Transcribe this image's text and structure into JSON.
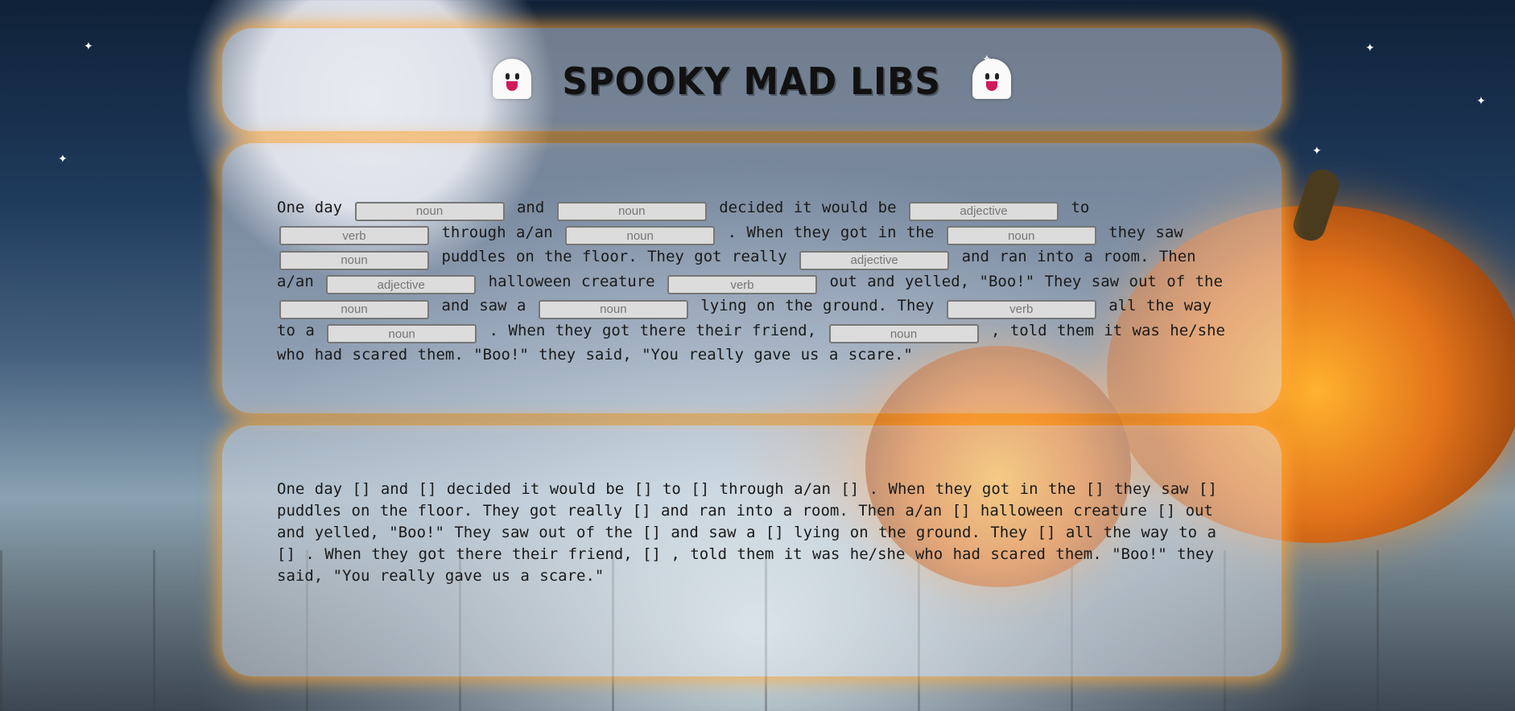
{
  "title": {
    "text": "SPOOKY MAD LIBS",
    "left_icon": "ghost-emoji-icon",
    "right_icon": "ghost-emoji-icon"
  },
  "form": {
    "text": {
      "t1": "One day",
      "t2": "and",
      "t3": "decided it would be",
      "t4": "to",
      "t5": "through a/an",
      "t6": ". When they got in the",
      "t7": "they saw",
      "t8": "puddles on the floor. They got really",
      "t9": "and ran into a room. Then a/an",
      "t10": "halloween creature",
      "t11": "out and yelled, \"Boo!\" They saw out of the",
      "t12": "and saw a",
      "t13": "lying on the ground. They",
      "t14": "all the way to a",
      "t15": ". When they got there their friend,",
      "t16": ", told them it was he/she who had scared them. \"Boo!\" they said, \"You really gave us a scare.\""
    },
    "blanks": [
      "noun",
      "noun",
      "adjective",
      "verb",
      "noun",
      "noun",
      "noun",
      "adjective",
      "adjective",
      "verb",
      "noun",
      "noun",
      "verb",
      "noun",
      "noun"
    ]
  },
  "output": {
    "text": "One day []  and []  decided it would be []  to []  through a/an []  . When they got in the []  they saw []  puddles on the floor. They got really []  and ran into a room. Then a/an []  halloween creature []  out and yelled, \"Boo!\" They saw out of the []  and saw a []  lying on the ground. They []  all the way to a []  . When they got there their friend, []  , told them it was he/she who had scared them. \"Boo!\" they said, \"You really gave us a scare.\""
  },
  "colors": {
    "panel_glow": "#ffaa3c",
    "input_bg": "#dcdcdc",
    "input_border": "#777777",
    "ghost_tongue": "#d0195f"
  }
}
